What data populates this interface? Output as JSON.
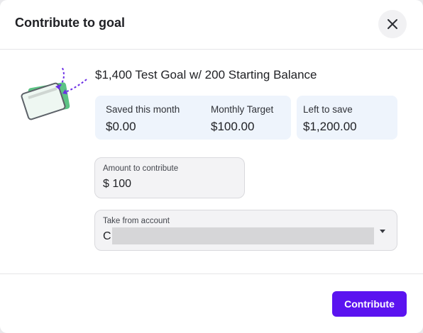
{
  "dialog": {
    "title": "Contribute to goal",
    "close_icon": "close-icon"
  },
  "goal": {
    "name": "$1,400 Test Goal w/ 200 Starting Balance",
    "illustration_icon": "goal-cards-illustration"
  },
  "stats": [
    {
      "label": "Saved this month",
      "value": "$0.00"
    },
    {
      "label": "Monthly Target",
      "value": "$100.00"
    },
    {
      "label": "Left to save",
      "value": "$1,200.00"
    }
  ],
  "amount_field": {
    "label": "Amount to contribute",
    "value": "$ 100"
  },
  "account_field": {
    "label": "Take from account",
    "value_prefix": "C",
    "dropdown_icon": "caret-down-icon"
  },
  "footer": {
    "contribute_label": "Contribute"
  },
  "colors": {
    "accent": "#5b13f0",
    "stat_bg": "#eef4fc",
    "illustration_green": "#5cc384",
    "illustration_arrow": "#6b2ee6"
  }
}
